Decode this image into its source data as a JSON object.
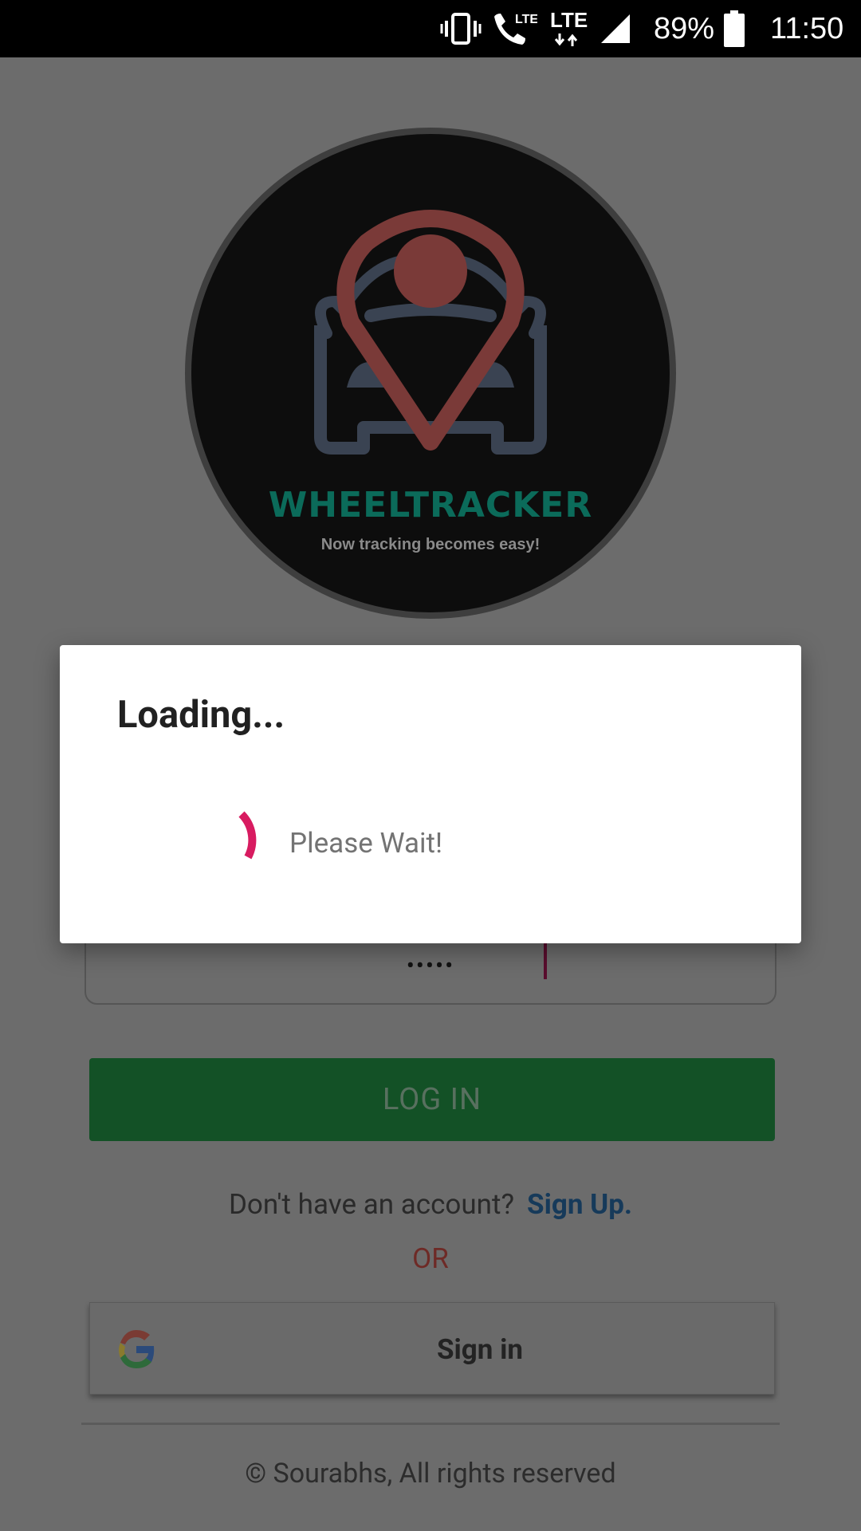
{
  "status_bar": {
    "battery": "89%",
    "time": "11:50",
    "network1": "LTE",
    "network2": "LTE"
  },
  "logo": {
    "brand": "WHEELTRACKER",
    "tagline": "Now tracking becomes easy!"
  },
  "form": {
    "password_value": "•••••"
  },
  "login_button": {
    "label": "LOG IN"
  },
  "signup": {
    "prompt": "Don't have an account?",
    "link": "Sign Up."
  },
  "or_label": "OR",
  "google_signin": {
    "label": "Sign in"
  },
  "footer": {
    "text": "© Sourabhs, All rights reserved"
  },
  "dialog": {
    "title": "Loading...",
    "message": "Please Wait!"
  },
  "colors": {
    "overlay_bg": "#6c6c6c",
    "login_button": "#135126",
    "spinner": "#d81b60",
    "pin_red": "#7a3a38",
    "brand_teal": "#0b6b5a"
  }
}
